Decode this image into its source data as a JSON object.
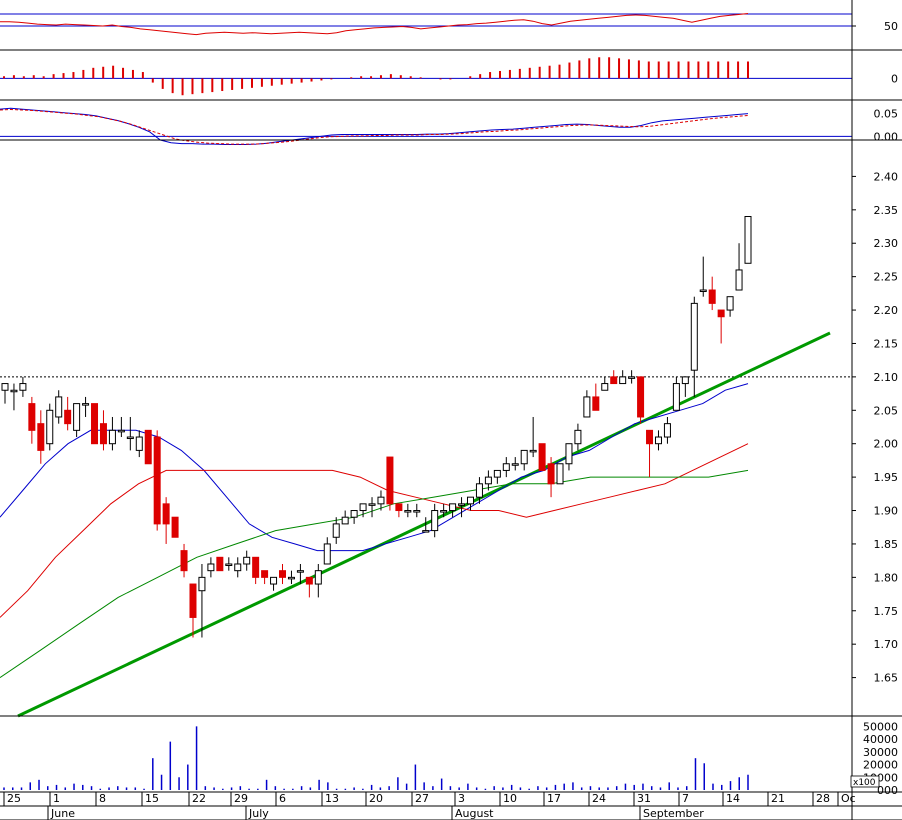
{
  "chart_data": [
    {
      "panel": "rsi",
      "type": "line",
      "ylim": [
        0,
        100
      ],
      "reference_levels": [
        75,
        50
      ],
      "y_ticks": [
        "50"
      ],
      "series": [
        {
          "values": [
            59,
            59,
            58,
            56,
            54,
            53,
            52,
            54,
            53,
            52,
            51,
            50,
            52,
            49,
            47,
            44,
            42,
            40,
            38,
            36,
            34,
            32,
            35,
            36,
            37,
            36,
            35,
            36,
            35,
            34,
            35,
            36,
            37,
            36,
            35,
            34,
            36,
            40,
            42,
            44,
            46,
            47,
            48,
            49,
            47,
            44,
            46,
            48,
            50,
            52,
            53,
            55,
            56,
            58,
            60,
            62,
            63,
            60,
            55,
            52,
            56,
            60,
            62,
            64,
            66,
            68,
            70,
            72,
            73,
            72,
            70,
            68,
            66,
            62,
            58,
            62,
            66,
            70,
            72,
            74,
            76
          ]
        }
      ]
    },
    {
      "panel": "macd-histogram",
      "type": "bar",
      "ylim": [
        -0.03,
        0.025
      ],
      "y_ticks": [
        "0"
      ],
      "values": [
        0.002,
        0.003,
        0.002,
        0.003,
        0.002,
        0.004,
        0.005,
        0.006,
        0.008,
        0.01,
        0.011,
        0.012,
        0.01,
        0.008,
        0.006,
        -0.004,
        -0.01,
        -0.014,
        -0.016,
        -0.015,
        -0.014,
        -0.013,
        -0.012,
        -0.011,
        -0.01,
        -0.009,
        -0.008,
        -0.007,
        -0.006,
        -0.005,
        -0.004,
        -0.003,
        -0.002,
        -0.001,
        0.0,
        0.001,
        0.002,
        0.002,
        0.003,
        0.004,
        0.003,
        0.002,
        0.001,
        0.0,
        -0.001,
        -0.001,
        0.0,
        0.002,
        0.004,
        0.006,
        0.007,
        0.008,
        0.009,
        0.01,
        0.011,
        0.012,
        0.013,
        0.015,
        0.017,
        0.019,
        0.02,
        0.02,
        0.019,
        0.018,
        0.017,
        0.016,
        0.016,
        0.016,
        0.016,
        0.016,
        0.016,
        0.016,
        0.016,
        0.016,
        0.016,
        0.016
      ]
    },
    {
      "panel": "macd",
      "type": "line",
      "ylim": [
        -0.03,
        0.08
      ],
      "y_ticks": [
        "0.05",
        "0.00"
      ],
      "series": [
        {
          "values": [
            0.06,
            0.062,
            0.06,
            0.058,
            0.056,
            0.054,
            0.052,
            0.05,
            0.048,
            0.045,
            0.04,
            0.035,
            0.028,
            0.02,
            0.01,
            -0.008,
            -0.014,
            -0.016,
            -0.016,
            -0.017,
            -0.017,
            -0.018,
            -0.018,
            -0.018,
            -0.017,
            -0.015,
            -0.012,
            -0.009,
            -0.006,
            -0.003,
            0.0,
            0.003,
            0.004,
            0.004,
            0.004,
            0.004,
            0.004,
            0.004,
            0.004,
            0.004,
            0.005,
            0.005,
            0.006,
            0.008,
            0.01,
            0.012,
            0.014,
            0.015,
            0.016,
            0.018,
            0.02,
            0.022,
            0.024,
            0.026,
            0.027,
            0.026,
            0.024,
            0.022,
            0.02,
            0.02,
            0.024,
            0.03,
            0.034,
            0.036,
            0.038,
            0.04,
            0.042,
            0.044,
            0.046,
            0.048,
            0.05
          ]
        },
        {
          "values": [
            0.058,
            0.059,
            0.058,
            0.057,
            0.055,
            0.053,
            0.051,
            0.049,
            0.046,
            0.043,
            0.038,
            0.033,
            0.026,
            0.018,
            0.01,
            0.002,
            -0.006,
            -0.01,
            -0.013,
            -0.015,
            -0.016,
            -0.017,
            -0.017,
            -0.017,
            -0.016,
            -0.014,
            -0.012,
            -0.009,
            -0.006,
            -0.003,
            -0.001,
            0.0,
            0.001,
            0.001,
            0.002,
            0.002,
            0.003,
            0.003,
            0.003,
            0.004,
            0.004,
            0.005,
            0.006,
            0.008,
            0.01,
            0.011,
            0.013,
            0.014,
            0.016,
            0.018,
            0.02,
            0.022,
            0.024,
            0.025,
            0.025,
            0.024,
            0.023,
            0.022,
            0.021,
            0.022,
            0.025,
            0.028,
            0.031,
            0.034,
            0.037,
            0.04,
            0.042,
            0.044,
            0.046
          ]
        }
      ]
    },
    {
      "panel": "price",
      "type": "candlestick",
      "ylim": [
        1.6,
        2.45
      ],
      "y_ticks": [
        "2.40",
        "2.35",
        "2.30",
        "2.25",
        "2.20",
        "2.15",
        "2.10",
        "2.05",
        "2.00",
        "1.95",
        "1.90",
        "1.85",
        "1.80",
        "1.75",
        "1.70",
        "1.65"
      ],
      "reference_line": 2.1,
      "candles": [
        {
          "o": 2.08,
          "h": 2.09,
          "l": 2.06,
          "c": 2.09
        },
        {
          "o": 2.08,
          "h": 2.09,
          "l": 2.05,
          "c": 2.08
        },
        {
          "o": 2.08,
          "h": 2.1,
          "l": 2.07,
          "c": 2.09
        },
        {
          "o": 2.06,
          "h": 2.07,
          "l": 2.0,
          "c": 2.02
        },
        {
          "o": 2.03,
          "h": 2.05,
          "l": 1.97,
          "c": 1.99
        },
        {
          "o": 2.0,
          "h": 2.06,
          "l": 1.99,
          "c": 2.05
        },
        {
          "o": 2.04,
          "h": 2.08,
          "l": 2.03,
          "c": 2.07
        },
        {
          "o": 2.05,
          "h": 2.07,
          "l": 2.02,
          "c": 2.03
        },
        {
          "o": 2.02,
          "h": 2.06,
          "l": 2.01,
          "c": 2.06
        },
        {
          "o": 2.06,
          "h": 2.07,
          "l": 2.04,
          "c": 2.06
        },
        {
          "o": 2.06,
          "h": 2.06,
          "l": 2.0,
          "c": 2.0
        },
        {
          "o": 2.03,
          "h": 2.05,
          "l": 1.99,
          "c": 2.0
        },
        {
          "o": 2.0,
          "h": 2.04,
          "l": 1.99,
          "c": 2.02
        },
        {
          "o": 2.02,
          "h": 2.04,
          "l": 2.01,
          "c": 2.02
        },
        {
          "o": 2.01,
          "h": 2.04,
          "l": 1.99,
          "c": 2.01
        },
        {
          "o": 1.99,
          "h": 2.02,
          "l": 1.98,
          "c": 2.01
        },
        {
          "o": 2.02,
          "h": 2.02,
          "l": 1.97,
          "c": 1.97
        },
        {
          "o": 2.01,
          "h": 2.02,
          "l": 1.87,
          "c": 1.88
        },
        {
          "o": 1.91,
          "h": 1.92,
          "l": 1.85,
          "c": 1.88
        },
        {
          "o": 1.89,
          "h": 1.89,
          "l": 1.86,
          "c": 1.86
        },
        {
          "o": 1.84,
          "h": 1.85,
          "l": 1.8,
          "c": 1.81
        },
        {
          "o": 1.79,
          "h": 1.79,
          "l": 1.71,
          "c": 1.74
        },
        {
          "o": 1.78,
          "h": 1.82,
          "l": 1.71,
          "c": 1.8
        },
        {
          "o": 1.81,
          "h": 1.83,
          "l": 1.8,
          "c": 1.82
        },
        {
          "o": 1.83,
          "h": 1.83,
          "l": 1.81,
          "c": 1.81
        },
        {
          "o": 1.82,
          "h": 1.83,
          "l": 1.81,
          "c": 1.82
        },
        {
          "o": 1.81,
          "h": 1.83,
          "l": 1.8,
          "c": 1.82
        },
        {
          "o": 1.82,
          "h": 1.84,
          "l": 1.81,
          "c": 1.83
        },
        {
          "o": 1.83,
          "h": 1.83,
          "l": 1.79,
          "c": 1.8
        },
        {
          "o": 1.81,
          "h": 1.81,
          "l": 1.79,
          "c": 1.8
        },
        {
          "o": 1.79,
          "h": 1.8,
          "l": 1.78,
          "c": 1.8
        },
        {
          "o": 1.81,
          "h": 1.82,
          "l": 1.79,
          "c": 1.8
        },
        {
          "o": 1.8,
          "h": 1.81,
          "l": 1.79,
          "c": 1.8
        },
        {
          "o": 1.81,
          "h": 1.82,
          "l": 1.79,
          "c": 1.81
        },
        {
          "o": 1.8,
          "h": 1.8,
          "l": 1.77,
          "c": 1.79
        },
        {
          "o": 1.79,
          "h": 1.82,
          "l": 1.77,
          "c": 1.81
        },
        {
          "o": 1.82,
          "h": 1.86,
          "l": 1.82,
          "c": 1.85
        },
        {
          "o": 1.86,
          "h": 1.89,
          "l": 1.85,
          "c": 1.88
        },
        {
          "o": 1.88,
          "h": 1.9,
          "l": 1.88,
          "c": 1.89
        },
        {
          "o": 1.89,
          "h": 1.9,
          "l": 1.88,
          "c": 1.9
        },
        {
          "o": 1.9,
          "h": 1.91,
          "l": 1.89,
          "c": 1.91
        },
        {
          "o": 1.91,
          "h": 1.92,
          "l": 1.89,
          "c": 1.91
        },
        {
          "o": 1.91,
          "h": 1.93,
          "l": 1.9,
          "c": 1.92
        },
        {
          "o": 1.98,
          "h": 1.98,
          "l": 1.9,
          "c": 1.91
        },
        {
          "o": 1.91,
          "h": 1.91,
          "l": 1.89,
          "c": 1.9
        },
        {
          "o": 1.9,
          "h": 1.91,
          "l": 1.89,
          "c": 1.9
        },
        {
          "o": 1.9,
          "h": 1.91,
          "l": 1.89,
          "c": 1.9
        },
        {
          "o": 1.87,
          "h": 1.89,
          "l": 1.87,
          "c": 1.87
        },
        {
          "o": 1.87,
          "h": 1.91,
          "l": 1.86,
          "c": 1.9
        },
        {
          "o": 1.9,
          "h": 1.91,
          "l": 1.89,
          "c": 1.9
        },
        {
          "o": 1.9,
          "h": 1.91,
          "l": 1.89,
          "c": 1.91
        },
        {
          "o": 1.91,
          "h": 1.92,
          "l": 1.89,
          "c": 1.91
        },
        {
          "o": 1.91,
          "h": 1.92,
          "l": 1.9,
          "c": 1.92
        },
        {
          "o": 1.92,
          "h": 1.95,
          "l": 1.91,
          "c": 1.94
        },
        {
          "o": 1.94,
          "h": 1.96,
          "l": 1.93,
          "c": 1.95
        },
        {
          "o": 1.95,
          "h": 1.96,
          "l": 1.94,
          "c": 1.96
        },
        {
          "o": 1.96,
          "h": 1.98,
          "l": 1.95,
          "c": 1.97
        },
        {
          "o": 1.97,
          "h": 1.98,
          "l": 1.96,
          "c": 1.97
        },
        {
          "o": 1.97,
          "h": 1.99,
          "l": 1.96,
          "c": 1.99
        },
        {
          "o": 1.99,
          "h": 2.04,
          "l": 1.98,
          "c": 1.99
        },
        {
          "o": 2.0,
          "h": 2.0,
          "l": 1.96,
          "c": 1.96
        },
        {
          "o": 1.97,
          "h": 1.98,
          "l": 1.92,
          "c": 1.94
        },
        {
          "o": 1.94,
          "h": 1.97,
          "l": 1.94,
          "c": 1.97
        },
        {
          "o": 1.97,
          "h": 2.0,
          "l": 1.96,
          "c": 2.0
        },
        {
          "o": 2.0,
          "h": 2.03,
          "l": 1.99,
          "c": 2.02
        },
        {
          "o": 2.04,
          "h": 2.08,
          "l": 2.04,
          "c": 2.07
        },
        {
          "o": 2.07,
          "h": 2.09,
          "l": 2.05,
          "c": 2.05
        },
        {
          "o": 2.08,
          "h": 2.1,
          "l": 2.08,
          "c": 2.09
        },
        {
          "o": 2.1,
          "h": 2.11,
          "l": 2.09,
          "c": 2.09
        },
        {
          "o": 2.09,
          "h": 2.11,
          "l": 2.09,
          "c": 2.1
        },
        {
          "o": 2.1,
          "h": 2.11,
          "l": 2.09,
          "c": 2.1
        },
        {
          "o": 2.1,
          "h": 2.1,
          "l": 2.03,
          "c": 2.04
        },
        {
          "o": 2.02,
          "h": 2.02,
          "l": 1.95,
          "c": 2.0
        },
        {
          "o": 2.0,
          "h": 2.02,
          "l": 1.99,
          "c": 2.01
        },
        {
          "o": 2.01,
          "h": 2.04,
          "l": 2.0,
          "c": 2.03
        },
        {
          "o": 2.05,
          "h": 2.1,
          "l": 2.05,
          "c": 2.09
        },
        {
          "o": 2.09,
          "h": 2.1,
          "l": 2.07,
          "c": 2.1
        },
        {
          "o": 2.11,
          "h": 2.22,
          "l": 2.07,
          "c": 2.21
        },
        {
          "o": 2.23,
          "h": 2.28,
          "l": 2.22,
          "c": 2.23
        },
        {
          "o": 2.23,
          "h": 2.25,
          "l": 2.2,
          "c": 2.21
        },
        {
          "o": 2.2,
          "h": 2.2,
          "l": 2.15,
          "c": 2.19
        },
        {
          "o": 2.2,
          "h": 2.22,
          "l": 2.19,
          "c": 2.22
        },
        {
          "o": 2.23,
          "h": 2.3,
          "l": 2.23,
          "c": 2.26
        },
        {
          "o": 2.27,
          "h": 2.34,
          "l": 2.27,
          "c": 2.34
        }
      ],
      "overlays": [
        {
          "color": "#0000cc",
          "values": [
            1.89,
            1.93,
            1.97,
            2.0,
            2.02,
            2.02,
            2.02,
            2.01,
            1.99,
            1.96,
            1.92,
            1.88,
            1.86,
            1.85,
            1.84,
            1.84,
            1.84,
            1.85,
            1.86,
            1.87,
            1.89,
            1.91,
            1.93,
            1.95,
            1.96,
            1.98,
            1.99,
            2.01,
            2.03,
            2.04,
            2.05,
            2.06,
            2.08,
            2.09
          ]
        },
        {
          "color": "#dd0000",
          "values": [
            1.74,
            1.78,
            1.83,
            1.87,
            1.91,
            1.94,
            1.96,
            1.96,
            1.96,
            1.96,
            1.96,
            1.96,
            1.96,
            1.95,
            1.93,
            1.92,
            1.91,
            1.9,
            1.9,
            1.89,
            1.9,
            1.91,
            1.92,
            1.93,
            1.94,
            1.96,
            1.98,
            2.0
          ]
        },
        {
          "color": "#008800",
          "values": [
            1.65,
            1.69,
            1.73,
            1.77,
            1.8,
            1.83,
            1.85,
            1.87,
            1.88,
            1.89,
            1.91,
            1.92,
            1.93,
            1.94,
            1.94,
            1.95,
            1.95,
            1.95,
            1.95,
            1.96
          ]
        }
      ],
      "trendline": {
        "from": [
          1.56,
          1.6
        ],
        "to": [
          2.11,
          2.125
        ]
      }
    },
    {
      "panel": "volume",
      "type": "bar",
      "y_ticks": [
        "50000",
        "40000",
        "30000",
        "20000",
        "10000",
        "000"
      ],
      "multiplier_label": "x100",
      "values": [
        2000,
        2000,
        2000,
        6000,
        8000,
        3000,
        4000,
        2000,
        5000,
        4000,
        3000,
        1000,
        2000,
        3000,
        2000,
        2000,
        1000,
        25000,
        12000,
        38000,
        10000,
        20000,
        50000,
        3000,
        2000,
        1000,
        2000,
        3000,
        1000,
        1000,
        8000,
        3000,
        1000,
        1000,
        3000,
        2000,
        8000,
        6000,
        1000,
        1000,
        2000,
        1000,
        4000,
        2000,
        3000,
        10000,
        5000,
        20000,
        6000,
        3000,
        9000,
        3000,
        2000,
        5000,
        2000,
        1000,
        3000,
        2000,
        4000,
        2000,
        1000,
        3000,
        2000,
        4000,
        5000,
        6000,
        2000,
        3000,
        2000,
        2000,
        3000,
        5000,
        4000,
        5000,
        3000,
        2000,
        6000,
        2000,
        3000,
        25000,
        21000,
        5000,
        4000,
        7000,
        10000,
        12000
      ]
    },
    {
      "panel": "x-axis",
      "type": "axis",
      "x_ticks": [
        "25",
        "1",
        "8",
        "15",
        "22",
        "29",
        "6",
        "13",
        "20",
        "27",
        "3",
        "10",
        "17",
        "24",
        "31",
        "7",
        "14",
        "21",
        "28",
        "Oc"
      ],
      "months": [
        "June",
        "July",
        "August",
        "September"
      ]
    }
  ]
}
